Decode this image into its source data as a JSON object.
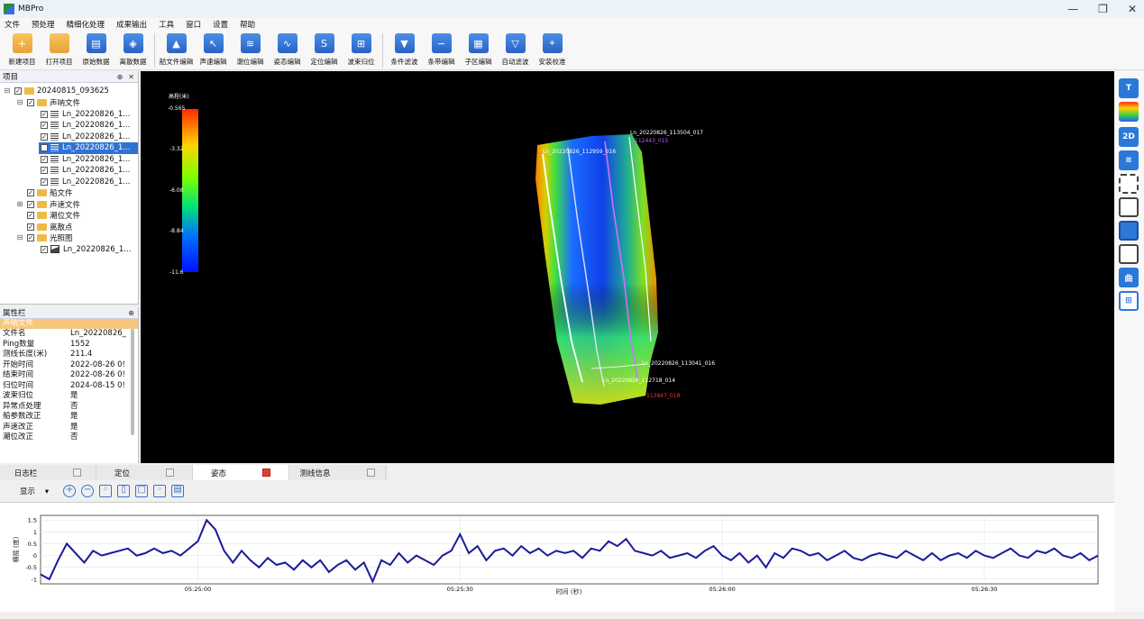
{
  "window": {
    "title": "MBPro",
    "controls": [
      "—",
      "❐",
      "✕"
    ]
  },
  "menu": [
    "文件",
    "预处理",
    "精细化处理",
    "成果输出",
    "工具",
    "窗口",
    "设置",
    "帮助"
  ],
  "toolbar": {
    "group1": [
      "新建项目",
      "打开项目",
      "原始数据",
      "离散数据"
    ],
    "group2": [
      "船文件编辑",
      "声速编辑",
      "潮位编辑",
      "姿态编辑",
      "定位编辑",
      "波束归位"
    ],
    "group3": [
      "条件滤波",
      "条带编辑",
      "子区编辑",
      "自动滤波",
      "安装校准"
    ]
  },
  "project_panel": {
    "title": "项目",
    "pin": "⊕",
    "close": "✕",
    "root": "20240815_093625",
    "sonar_folder": "声呐文件",
    "sonar_files": [
      "Ln_20220826_1...",
      "Ln_20220826_1...",
      "Ln_20220826_1...",
      "Ln_20220826_1...",
      "Ln_20220826_1...",
      "Ln_20220826_1...",
      "Ln_20220826_1..."
    ],
    "folders": [
      "船文件",
      "声速文件",
      "潮位文件",
      "离散点",
      "光照图"
    ],
    "image_file": "Ln_20220826_1..."
  },
  "attr_panel": {
    "title": "属性栏",
    "section": "声呐文件",
    "rows": [
      {
        "k": "文件名",
        "v": "Ln_20220826_"
      },
      {
        "k": "Ping数量",
        "v": "1552"
      },
      {
        "k": "测线长度(米)",
        "v": "211.4"
      },
      {
        "k": "开始时间",
        "v": "2022-08-26 0!"
      },
      {
        "k": "结束时间",
        "v": "2022-08-26 0!"
      },
      {
        "k": "归位时间",
        "v": "2024-08-15 0!"
      },
      {
        "k": "波束归位",
        "v": "是"
      },
      {
        "k": "异常点处理",
        "v": "否"
      },
      {
        "k": "船参数改正",
        "v": "是"
      },
      {
        "k": "声速改正",
        "v": "是"
      },
      {
        "k": "潮位改正",
        "v": "否"
      }
    ]
  },
  "viewport": {
    "legend_title": "高程(米)",
    "legend_ticks": [
      "-0.565",
      "-3.32",
      "-6.08",
      "-8.84",
      "-11.6"
    ],
    "line_labels": [
      {
        "text": "Ln_20220826_113504_017",
        "color": "#ffffff"
      },
      {
        "text": "112443_015",
        "color": "#b05cff"
      },
      {
        "text": "Ln_20220826_112959_016",
        "color": "#ffffff"
      },
      {
        "text": "Ln_20220826_113041_016",
        "color": "#ffffff"
      },
      {
        "text": "Ln_20220826_112718_014",
        "color": "#ffffff"
      },
      {
        "text": "113847_018",
        "color": "#ff3030"
      }
    ]
  },
  "right_tools": [
    "T",
    "",
    "2D",
    "",
    "",
    "",
    "",
    "",
    "曲",
    ""
  ],
  "bottom_tabs": [
    "日志栏",
    "定位",
    "姿态",
    "测线信息"
  ],
  "plot_toolbar": {
    "display": "显示",
    "dropdown": "▾"
  },
  "chart_data": {
    "type": "line",
    "title": "",
    "xlabel": "时间 (秒)",
    "ylabel": "横摇 (度)",
    "ylim": [
      -1.2,
      1.7
    ],
    "yticks": [
      "1.5",
      "1",
      "0.5",
      "0",
      "-0.5",
      "-1"
    ],
    "xticks": [
      "05:25:00",
      "05:25:30",
      "05:26:00",
      "05:26:30"
    ],
    "xlim_seconds": [
      -18,
      103
    ],
    "x": [
      -18,
      -17,
      -16,
      -15,
      -14,
      -13,
      -12,
      -11,
      -10,
      -9,
      -8,
      -7,
      -6,
      -5,
      -4,
      -3,
      -2,
      -1,
      0,
      1,
      2,
      3,
      4,
      5,
      6,
      7,
      8,
      9,
      10,
      11,
      12,
      13,
      14,
      15,
      16,
      17,
      18,
      19,
      20,
      21,
      22,
      23,
      24,
      25,
      26,
      27,
      28,
      29,
      30,
      31,
      32,
      33,
      34,
      35,
      36,
      37,
      38,
      39,
      40,
      41,
      42,
      43,
      44,
      45,
      46,
      47,
      48,
      49,
      50,
      51,
      52,
      53,
      54,
      55,
      56,
      57,
      58,
      59,
      60,
      61,
      62,
      63,
      64,
      65,
      66,
      67,
      68,
      69,
      70,
      71,
      72,
      73,
      74,
      75,
      76,
      77,
      78,
      79,
      80,
      81,
      82,
      83,
      84,
      85,
      86,
      87,
      88,
      89,
      90,
      91,
      92,
      93,
      94,
      95,
      96,
      97,
      98,
      99,
      100,
      101,
      102,
      103
    ],
    "values": [
      -0.8,
      -1.0,
      -0.2,
      0.5,
      0.1,
      -0.3,
      0.2,
      0.0,
      0.1,
      0.2,
      0.3,
      0.0,
      0.1,
      0.3,
      0.1,
      0.2,
      0.0,
      0.3,
      0.6,
      1.5,
      1.1,
      0.2,
      -0.3,
      0.2,
      -0.2,
      -0.5,
      -0.1,
      -0.4,
      -0.3,
      -0.6,
      -0.2,
      -0.5,
      -0.2,
      -0.7,
      -0.4,
      -0.2,
      -0.6,
      -0.3,
      -1.1,
      -0.2,
      -0.4,
      0.1,
      -0.3,
      0.0,
      -0.2,
      -0.4,
      0.0,
      0.2,
      0.9,
      0.1,
      0.4,
      -0.2,
      0.2,
      0.3,
      0.0,
      0.4,
      0.1,
      0.3,
      0.0,
      0.2,
      0.1,
      0.2,
      -0.1,
      0.3,
      0.2,
      0.6,
      0.4,
      0.7,
      0.2,
      0.1,
      0.0,
      0.2,
      -0.1,
      0.0,
      0.1,
      -0.1,
      0.2,
      0.4,
      0.0,
      -0.2,
      0.1,
      -0.3,
      0.0,
      -0.5,
      0.1,
      -0.1,
      0.3,
      0.2,
      0.0,
      0.1,
      -0.2,
      0.0,
      0.2,
      -0.1,
      -0.2,
      0.0,
      0.1,
      0.0,
      -0.1,
      0.2,
      0.0,
      -0.2,
      0.1,
      -0.2,
      0.0,
      0.1,
      -0.1,
      0.2,
      0.0,
      -0.1,
      0.1,
      0.3,
      0.0,
      -0.1,
      0.2,
      0.1,
      0.3,
      0.0,
      -0.1,
      0.1,
      -0.2,
      0.0
    ]
  }
}
